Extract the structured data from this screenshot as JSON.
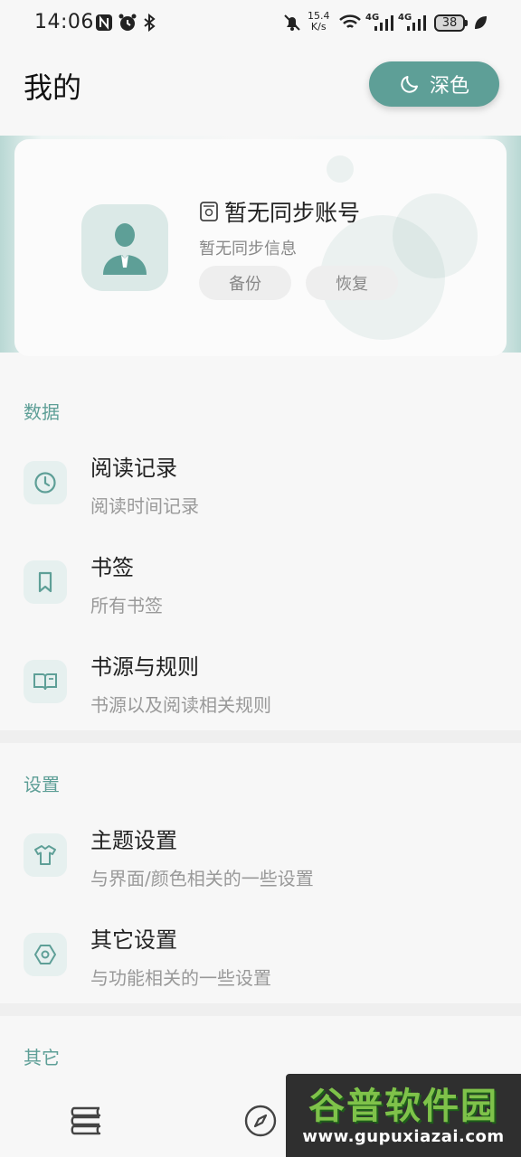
{
  "status_bar": {
    "time": "14:06",
    "net_speed_value": "15.4",
    "net_speed_unit": "K/s",
    "signal_1": "4G",
    "signal_2": "4G",
    "battery": "38"
  },
  "header": {
    "title": "我的",
    "theme_button_label": "深色"
  },
  "account": {
    "name": "暂无同步账号",
    "info": "暂无同步信息",
    "backup_label": "备份",
    "restore_label": "恢复"
  },
  "sections": {
    "data": {
      "title": "数据",
      "items": [
        {
          "title": "阅读记录",
          "subtitle": "阅读时间记录",
          "icon": "clock-icon"
        },
        {
          "title": "书签",
          "subtitle": "所有书签",
          "icon": "bookmark-icon"
        },
        {
          "title": "书源与规则",
          "subtitle": "书源以及阅读相关规则",
          "icon": "book-open-icon"
        }
      ]
    },
    "settings": {
      "title": "设置",
      "items": [
        {
          "title": "主题设置",
          "subtitle": "与界面/颜色相关的一些设置",
          "icon": "tshirt-icon"
        },
        {
          "title": "其它设置",
          "subtitle": "与功能相关的一些设置",
          "icon": "hexagon-settings-icon"
        }
      ]
    },
    "other": {
      "title": "其它"
    }
  },
  "bottom_nav": {
    "items": [
      {
        "icon": "bookshelf-icon"
      },
      {
        "icon": "compass-icon"
      }
    ]
  },
  "watermark": {
    "title": "谷普软件园",
    "url": "www.gupuxiazai.com"
  },
  "colors": {
    "accent": "#5e9f97",
    "accent_light": "#e6f0ef",
    "background": "#f7f7f7"
  }
}
